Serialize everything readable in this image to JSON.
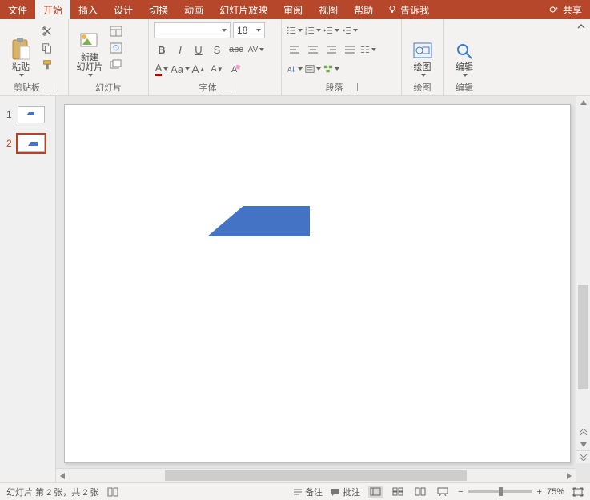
{
  "tabs": {
    "file": "文件",
    "home": "开始",
    "insert": "插入",
    "design": "设计",
    "transition": "切换",
    "animation": "动画",
    "slideshow": "幻灯片放映",
    "review": "审阅",
    "view": "视图",
    "help": "帮助",
    "tellme": "告诉我",
    "share": "共享"
  },
  "ribbon": {
    "clipboard": {
      "paste": "粘贴",
      "label": "剪贴板"
    },
    "slides": {
      "newSlide": "新建\n幻灯片",
      "label": "幻灯片"
    },
    "font": {
      "name": "",
      "size": "18",
      "label": "字体",
      "bold": "B",
      "italic": "I",
      "underline": "U",
      "strike": "S",
      "shadow_abc": "abc",
      "charspace": "AV",
      "a1": "A",
      "aa": "Aa",
      "aplus": "A",
      "aminus": "A"
    },
    "paragraph": {
      "label": "段落"
    },
    "drawing": {
      "btn": "绘图",
      "label": "绘图"
    },
    "editing": {
      "btn": "编辑",
      "label": "编辑"
    }
  },
  "thumbs": [
    {
      "num": "1",
      "selected": false
    },
    {
      "num": "2",
      "selected": true
    }
  ],
  "status": {
    "slideinfo": "幻灯片 第 2 张，共 2 张",
    "notes": "备注",
    "comments": "批注",
    "zoom": "75%",
    "minus": "−",
    "plus": "+"
  }
}
